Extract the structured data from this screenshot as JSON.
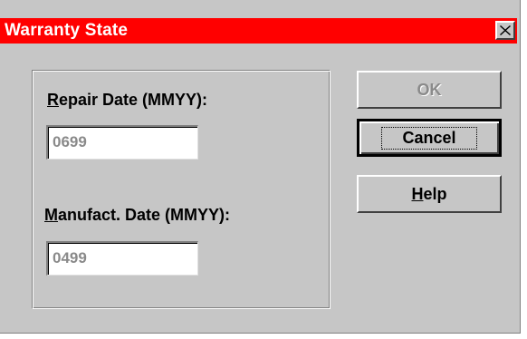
{
  "window": {
    "title": "Warranty State",
    "title_bar_color": "#ff0000",
    "close_icon": "close-icon"
  },
  "form": {
    "repair_date": {
      "label_mnemonic": "R",
      "label_rest": "epair Date (MMYY):",
      "value": "0699"
    },
    "manufact_date": {
      "label_mnemonic": "M",
      "label_rest": "anufact. Date (MMYY):",
      "value": "0499"
    }
  },
  "buttons": {
    "ok": {
      "label": "OK",
      "enabled": false
    },
    "cancel": {
      "label": "Cancel",
      "default": true
    },
    "help": {
      "label_mnemonic": "H",
      "label_rest": "elp"
    }
  }
}
